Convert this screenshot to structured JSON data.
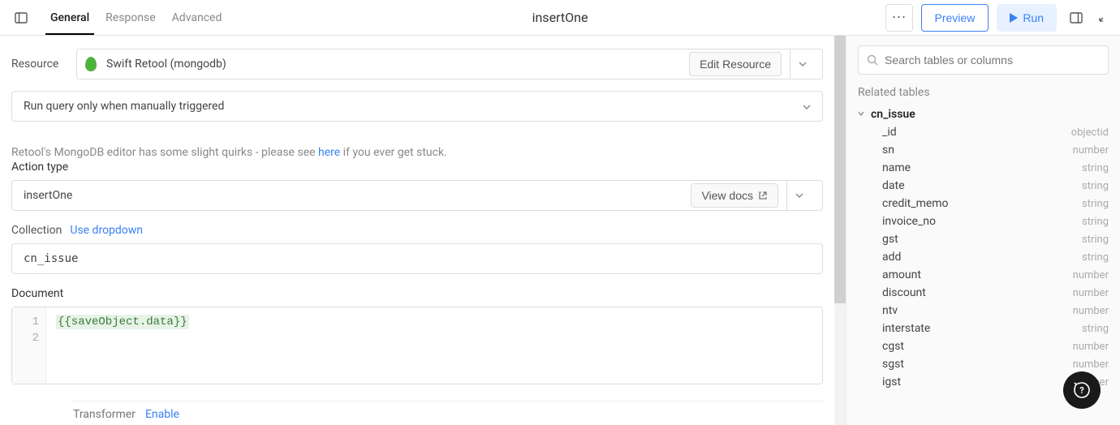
{
  "header": {
    "tabs": [
      "General",
      "Response",
      "Advanced"
    ],
    "title": "insertOne",
    "preview": "Preview",
    "run": "Run"
  },
  "resource": {
    "label": "Resource",
    "name": "Swift Retool (mongodb)",
    "edit": "Edit Resource"
  },
  "trigger": {
    "value": "Run query only when manually triggered"
  },
  "info": {
    "pre": "Retool's MongoDB editor has some slight quirks - please see ",
    "link": "here",
    "post": " if you ever get stuck."
  },
  "action": {
    "label": "Action type",
    "value": "insertOne",
    "viewDocs": "View docs"
  },
  "collection": {
    "label": "Collection",
    "useDropdown": "Use dropdown",
    "value": "cn_issue"
  },
  "document": {
    "label": "Document",
    "line1": "{{saveObject.data}}"
  },
  "transformer": {
    "label": "Transformer",
    "enable": "Enable"
  },
  "search": {
    "placeholder": "Search tables or columns"
  },
  "relatedLabel": "Related tables",
  "tree": {
    "root": "cn_issue",
    "fields": [
      {
        "name": "_id",
        "type": "objectid"
      },
      {
        "name": "sn",
        "type": "number"
      },
      {
        "name": "name",
        "type": "string"
      },
      {
        "name": "date",
        "type": "string"
      },
      {
        "name": "credit_memo",
        "type": "string"
      },
      {
        "name": "invoice_no",
        "type": "string"
      },
      {
        "name": "gst",
        "type": "string"
      },
      {
        "name": "add",
        "type": "string"
      },
      {
        "name": "amount",
        "type": "number"
      },
      {
        "name": "discount",
        "type": "number"
      },
      {
        "name": "ntv",
        "type": "number"
      },
      {
        "name": "interstate",
        "type": "string"
      },
      {
        "name": "cgst",
        "type": "number"
      },
      {
        "name": "sgst",
        "type": "number"
      },
      {
        "name": "igst",
        "type": "number"
      }
    ]
  }
}
